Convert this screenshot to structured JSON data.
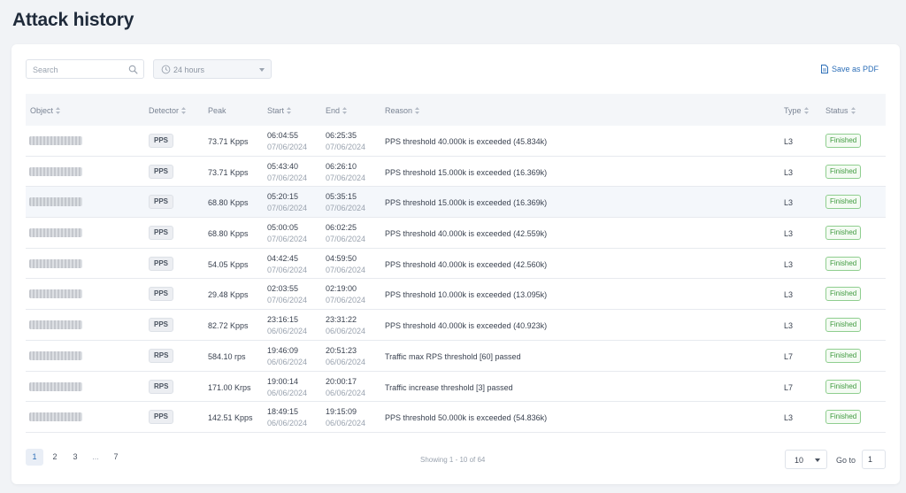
{
  "page": {
    "title": "Attack history"
  },
  "toolbar": {
    "search_placeholder": "Search",
    "time_range": "24 hours",
    "save_pdf": "Save as PDF"
  },
  "table": {
    "columns": [
      "Object",
      "Detector",
      "Peak",
      "Start",
      "End",
      "Reason",
      "Type",
      "Status"
    ],
    "rows": [
      {
        "detector": "PPS",
        "peak": "73.71 Kpps",
        "start_time": "06:04:55",
        "start_date": "07/06/2024",
        "end_time": "06:25:35",
        "end_date": "07/06/2024",
        "reason": "PPS threshold 40.000k is exceeded (45.834k)",
        "type": "L3",
        "status": "Finished"
      },
      {
        "detector": "PPS",
        "peak": "73.71 Kpps",
        "start_time": "05:43:40",
        "start_date": "07/06/2024",
        "end_time": "06:26:10",
        "end_date": "07/06/2024",
        "reason": "PPS threshold 15.000k is exceeded (16.369k)",
        "type": "L3",
        "status": "Finished"
      },
      {
        "detector": "PPS",
        "peak": "68.80 Kpps",
        "start_time": "05:20:15",
        "start_date": "07/06/2024",
        "end_time": "05:35:15",
        "end_date": "07/06/2024",
        "reason": "PPS threshold 15.000k is exceeded (16.369k)",
        "type": "L3",
        "status": "Finished"
      },
      {
        "detector": "PPS",
        "peak": "68.80 Kpps",
        "start_time": "05:00:05",
        "start_date": "07/06/2024",
        "end_time": "06:02:25",
        "end_date": "07/06/2024",
        "reason": "PPS threshold 40.000k is exceeded (42.559k)",
        "type": "L3",
        "status": "Finished"
      },
      {
        "detector": "PPS",
        "peak": "54.05 Kpps",
        "start_time": "04:42:45",
        "start_date": "07/06/2024",
        "end_time": "04:59:50",
        "end_date": "07/06/2024",
        "reason": "PPS threshold 40.000k is exceeded (42.560k)",
        "type": "L3",
        "status": "Finished"
      },
      {
        "detector": "PPS",
        "peak": "29.48 Kpps",
        "start_time": "02:03:55",
        "start_date": "07/06/2024",
        "end_time": "02:19:00",
        "end_date": "07/06/2024",
        "reason": "PPS threshold 10.000k is exceeded (13.095k)",
        "type": "L3",
        "status": "Finished"
      },
      {
        "detector": "PPS",
        "peak": "82.72 Kpps",
        "start_time": "23:16:15",
        "start_date": "06/06/2024",
        "end_time": "23:31:22",
        "end_date": "06/06/2024",
        "reason": "PPS threshold 40.000k is exceeded (40.923k)",
        "type": "L3",
        "status": "Finished"
      },
      {
        "detector": "RPS",
        "peak": "584.10 rps",
        "start_time": "19:46:09",
        "start_date": "06/06/2024",
        "end_time": "20:51:23",
        "end_date": "06/06/2024",
        "reason": "Traffic max RPS threshold [60] passed",
        "type": "L7",
        "status": "Finished"
      },
      {
        "detector": "RPS",
        "peak": "171.00 Krps",
        "start_time": "19:00:14",
        "start_date": "06/06/2024",
        "end_time": "20:00:17",
        "end_date": "06/06/2024",
        "reason": "Traffic increase threshold [3] passed",
        "type": "L7",
        "status": "Finished"
      },
      {
        "detector": "PPS",
        "peak": "142.51 Kpps",
        "start_time": "18:49:15",
        "start_date": "06/06/2024",
        "end_time": "19:15:09",
        "end_date": "06/06/2024",
        "reason": "PPS threshold 50.000k is exceeded (54.836k)",
        "type": "L3",
        "status": "Finished"
      }
    ]
  },
  "pagination": {
    "pages": [
      "1",
      "2",
      "3",
      "...",
      "7"
    ],
    "current": "1",
    "showing": "Showing 1 - 10 of 64",
    "per_page": "10",
    "goto_label": "Go to",
    "goto_value": "1"
  },
  "colors": {
    "accent": "#2d6fb8",
    "status_green": "#3f9a3f",
    "background": "#f1f3f6"
  }
}
